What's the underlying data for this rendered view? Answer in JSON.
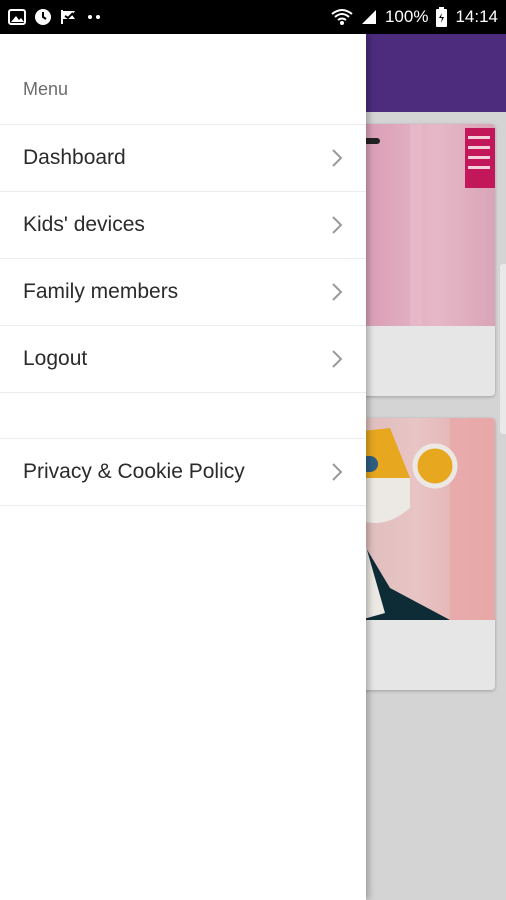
{
  "status_bar": {
    "battery": "100%",
    "time": "14:14",
    "left_icons": [
      "gallery-icon",
      "shield-icon",
      "check-flag-icon",
      "more-dots-icon"
    ],
    "right_icons": [
      "wifi-icon",
      "signal-icon",
      "battery-icon"
    ]
  },
  "drawer": {
    "title": "Menu",
    "items": [
      {
        "label": "Dashboard"
      },
      {
        "label": "Kids' devices"
      },
      {
        "label": "Family members"
      },
      {
        "label": "Logout"
      }
    ],
    "footer_items": [
      {
        "label": "Privacy & Cookie Policy"
      }
    ]
  },
  "colors": {
    "header": "#4d2c7e",
    "drawer_bg": "#ffffff",
    "text": "#2b2b2b",
    "muted": "#6b6b6b",
    "chevron": "#9a9a9a"
  }
}
